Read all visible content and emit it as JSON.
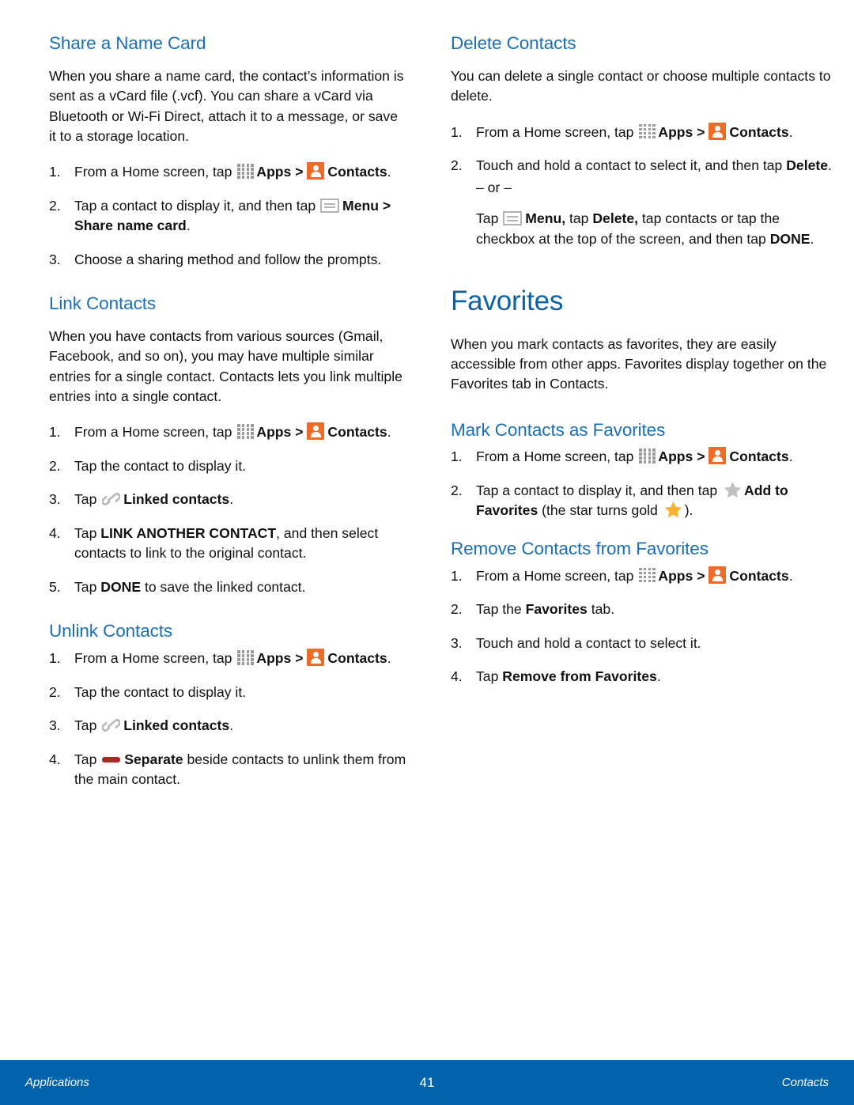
{
  "page": {
    "number": "41",
    "footer_left": "Applications",
    "footer_right": "Contacts",
    "accent_blue": "#1b6fb8",
    "title_blue": "#0a63a8",
    "footer_blue": "#0063ab",
    "contacts_icon_orange": "#f06a28",
    "star_gold": "#f9b233",
    "star_gray": "#c2c2c2",
    "separate_red": "#a82a22"
  },
  "left_column": {
    "share_name_card": {
      "heading": "Share a Name Card",
      "intro": "When you share a name card, the contact’s information is sent as a vCard file (.vcf). You can share a vCard via Bluetooth or Wi-Fi Direct, attach it to a message, or save it to a storage location.",
      "steps": [
        {
          "num": "1.",
          "pre": "From a Home screen, tap ",
          "apps_label": "Apps",
          "mid": " > ",
          "contacts_label": "Contacts",
          "post": "."
        },
        {
          "num": "2.",
          "pre": "Tap a contact to display it, and then tap ",
          "menu_label": "Menu > Share name card",
          "post": "."
        },
        {
          "num": "3.",
          "text": "Choose a sharing method and follow the prompts."
        }
      ]
    },
    "link_contacts": {
      "heading": "Link Contacts",
      "intro": "When you have contacts from various sources (Gmail, Facebook, and so on), you may have multiple similar entries for a single contact. Contacts lets you link multiple entries into a single contact.",
      "steps": [
        {
          "num": "1.",
          "pre": "From a Home screen, tap ",
          "apps_label": "Apps",
          "mid": " > ",
          "contacts_label": "Contacts",
          "post": "."
        },
        {
          "num": "2.",
          "text": "Tap the contact to display it."
        },
        {
          "num": "3.",
          "pre": "Tap ",
          "linked_label": "Linked contacts",
          "post": "."
        },
        {
          "num": "4.",
          "pre": "Tap ",
          "bold": "LINK ANOTHER CONTACT",
          "post": ", and then select contacts to link to the original contact."
        },
        {
          "num": "5.",
          "pre": "Tap ",
          "bold": "DONE",
          "post": " to save the linked contact."
        }
      ]
    },
    "unlink_contacts": {
      "heading": "Unlink Contacts",
      "steps": [
        {
          "num": "1.",
          "pre": "From a Home screen, tap ",
          "apps_label": "Apps",
          "mid": " > ",
          "contacts_label": "Contacts",
          "post": "."
        },
        {
          "num": "2.",
          "text": "Tap the contact to display it."
        },
        {
          "num": "3.",
          "pre": "Tap ",
          "linked_label": "Linked contacts",
          "post": "."
        },
        {
          "num": "4.",
          "pre": "Tap ",
          "bold": "Separate",
          "post": " beside contacts to unlink them from the main contact."
        }
      ]
    }
  },
  "right_column": {
    "delete_contacts": {
      "heading": "Delete Contacts",
      "intro": "You can delete a single contact or choose multiple contacts to delete.",
      "steps": [
        {
          "num": "1.",
          "pre": "From a Home screen, tap ",
          "apps_label": "Apps",
          "mid": " > ",
          "contacts_label": "Contacts",
          "post": "."
        },
        {
          "num": "2.",
          "pre": "Touch and hold a contact to select it, and then tap ",
          "bold": "Delete",
          "post": "."
        }
      ],
      "or_divider": "– or –",
      "alt_step": {
        "pre": "Tap ",
        "menu_bold": "Menu,",
        "mid1": " tap ",
        "delete_bold": "Delete,",
        "mid2": " tap contacts or tap the checkbox at the top of the screen, and then tap ",
        "done_bold": "DONE",
        "post": "."
      }
    },
    "favorites": {
      "heading": "Favorites",
      "intro": "When you mark contacts as favorites, they are easily accessible from other apps. Favorites display together on the Favorites tab in Contacts.",
      "mark_favorites": {
        "heading": "Mark Contacts as Favorites",
        "steps": [
          {
            "num": "1.",
            "pre": "From a Home screen, tap ",
            "apps_label": "Apps",
            "mid": " > ",
            "contacts_label": "Contacts",
            "post": "."
          },
          {
            "num": "2.",
            "pre": "Tap a contact to display it, and then tap ",
            "bold": "Add to Favorites",
            "mid": " (the star turns gold ",
            "post": ")."
          }
        ]
      },
      "remove_favorites": {
        "heading": "Remove Contacts from Favorites",
        "steps": [
          {
            "num": "1.",
            "pre": "From a Home screen, tap ",
            "apps_label": "Apps",
            "mid": " > ",
            "contacts_label": "Contacts",
            "post": "."
          },
          {
            "num": "2.",
            "pre": "Tap the ",
            "bold": "Favorites",
            "post": " tab."
          },
          {
            "num": "3.",
            "text": "Touch and hold a contact to select it."
          },
          {
            "num": "4.",
            "pre": "Tap ",
            "bold": "Remove from Favorites",
            "post": "."
          }
        ]
      }
    }
  }
}
